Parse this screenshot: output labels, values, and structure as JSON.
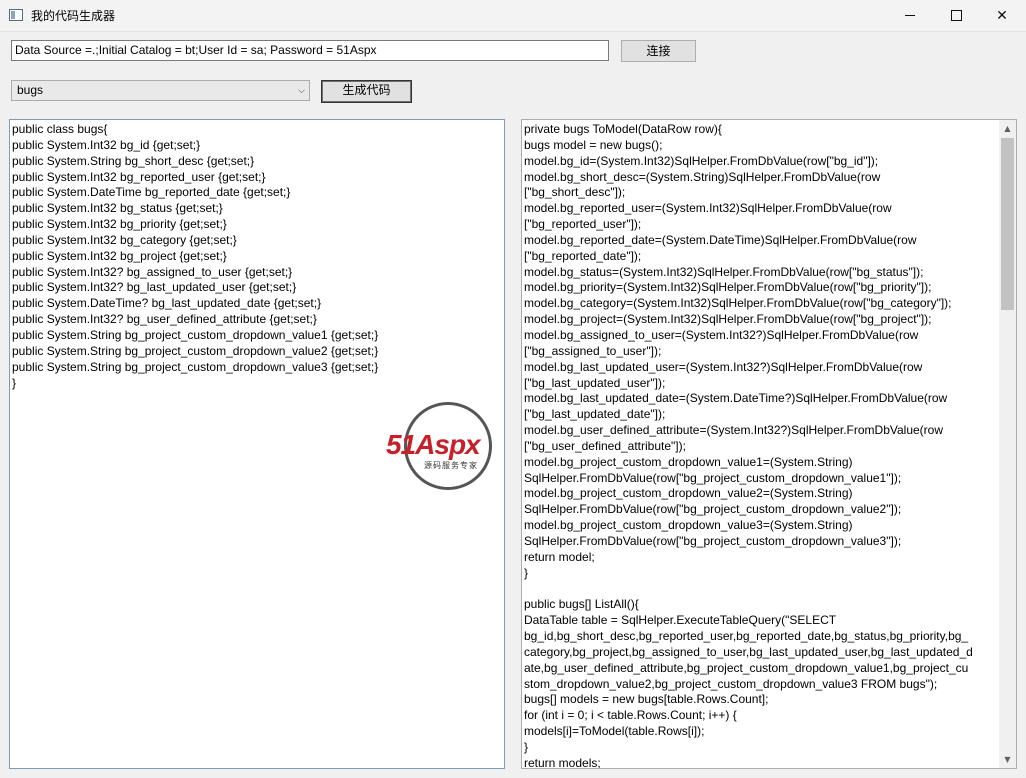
{
  "window": {
    "title": "我的代码生成器",
    "app_icon": "window-app-icon",
    "controls": [
      "minimize-icon",
      "maximize-icon",
      "close-icon"
    ]
  },
  "connection": {
    "value": "Data Source =.;Initial Catalog = bt;User Id = sa; Password = 51Aspx",
    "connect_label": "连接"
  },
  "table_select": {
    "selected": "bugs"
  },
  "generate_label": "生成代码",
  "model_code": "public class bugs{\npublic System.Int32 bg_id {get;set;}\npublic System.String bg_short_desc {get;set;}\npublic System.Int32 bg_reported_user {get;set;}\npublic System.DateTime bg_reported_date {get;set;}\npublic System.Int32 bg_status {get;set;}\npublic System.Int32 bg_priority {get;set;}\npublic System.Int32 bg_category {get;set;}\npublic System.Int32 bg_project {get;set;}\npublic System.Int32? bg_assigned_to_user {get;set;}\npublic System.Int32? bg_last_updated_user {get;set;}\npublic System.DateTime? bg_last_updated_date {get;set;}\npublic System.Int32? bg_user_defined_attribute {get;set;}\npublic System.String bg_project_custom_dropdown_value1 {get;set;}\npublic System.String bg_project_custom_dropdown_value2 {get;set;}\npublic System.String bg_project_custom_dropdown_value3 {get;set;}\n}",
  "dal_code": "private bugs ToModel(DataRow row){\nbugs model = new bugs();\nmodel.bg_id=(System.Int32)SqlHelper.FromDbValue(row[\"bg_id\"]);\nmodel.bg_short_desc=(System.String)SqlHelper.FromDbValue(row\n[\"bg_short_desc\"]);\nmodel.bg_reported_user=(System.Int32)SqlHelper.FromDbValue(row\n[\"bg_reported_user\"]);\nmodel.bg_reported_date=(System.DateTime)SqlHelper.FromDbValue(row\n[\"bg_reported_date\"]);\nmodel.bg_status=(System.Int32)SqlHelper.FromDbValue(row[\"bg_status\"]);\nmodel.bg_priority=(System.Int32)SqlHelper.FromDbValue(row[\"bg_priority\"]);\nmodel.bg_category=(System.Int32)SqlHelper.FromDbValue(row[\"bg_category\"]);\nmodel.bg_project=(System.Int32)SqlHelper.FromDbValue(row[\"bg_project\"]);\nmodel.bg_assigned_to_user=(System.Int32?)SqlHelper.FromDbValue(row\n[\"bg_assigned_to_user\"]);\nmodel.bg_last_updated_user=(System.Int32?)SqlHelper.FromDbValue(row\n[\"bg_last_updated_user\"]);\nmodel.bg_last_updated_date=(System.DateTime?)SqlHelper.FromDbValue(row\n[\"bg_last_updated_date\"]);\nmodel.bg_user_defined_attribute=(System.Int32?)SqlHelper.FromDbValue(row\n[\"bg_user_defined_attribute\"]);\nmodel.bg_project_custom_dropdown_value1=(System.String)\nSqlHelper.FromDbValue(row[\"bg_project_custom_dropdown_value1\"]);\nmodel.bg_project_custom_dropdown_value2=(System.String)\nSqlHelper.FromDbValue(row[\"bg_project_custom_dropdown_value2\"]);\nmodel.bg_project_custom_dropdown_value3=(System.String)\nSqlHelper.FromDbValue(row[\"bg_project_custom_dropdown_value3\"]);\nreturn model;\n}\n\npublic bugs[] ListAll(){\nDataTable table = SqlHelper.ExecuteTableQuery(\"SELECT\nbg_id,bg_short_desc,bg_reported_user,bg_reported_date,bg_status,bg_priority,bg_\ncategory,bg_project,bg_assigned_to_user,bg_last_updated_user,bg_last_updated_d\nate,bg_user_defined_attribute,bg_project_custom_dropdown_value1,bg_project_cu\nstom_dropdown_value2,bg_project_custom_dropdown_value3 FROM bugs\");\nbugs[] models = new bugs[table.Rows.Count];\nfor (int i = 0; i < table.Rows.Count; i++) {\nmodels[i]=ToModel(table.Rows[i]);\n}\nreturn models;",
  "watermark": {
    "logo": "51Aspx",
    "tagline": "源码服务专家"
  }
}
